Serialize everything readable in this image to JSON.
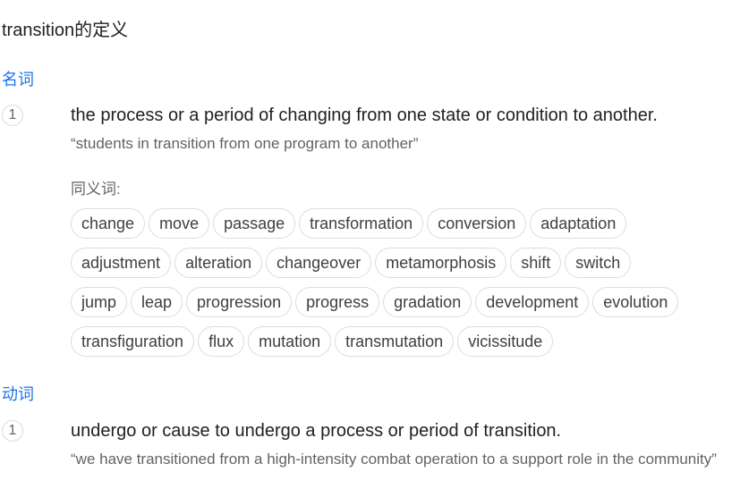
{
  "page_title": "transition的定义",
  "noun": {
    "pos_label": "名词",
    "number": "1",
    "definition": "the process or a period of changing from one state or condition to another.",
    "example": "“students in transition from one program to another”",
    "synonyms_label": "同义词:",
    "synonym_rows": [
      [
        "change",
        "move",
        "passage",
        "transformation",
        "conversion",
        "adaptation"
      ],
      [
        "adjustment",
        "alteration",
        "changeover",
        "metamorphosis",
        "shift",
        "switch"
      ],
      [
        "jump",
        "leap",
        "progression",
        "progress",
        "gradation",
        "development",
        "evolution"
      ],
      [
        "transfiguration",
        "flux",
        "mutation",
        "transmutation",
        "vicissitude"
      ]
    ]
  },
  "verb": {
    "pos_label": "动词",
    "number": "1",
    "definition": "undergo or cause to undergo a process or period of transition.",
    "example": "“we have transitioned from a high-intensity combat operation to a support role in the community”"
  }
}
